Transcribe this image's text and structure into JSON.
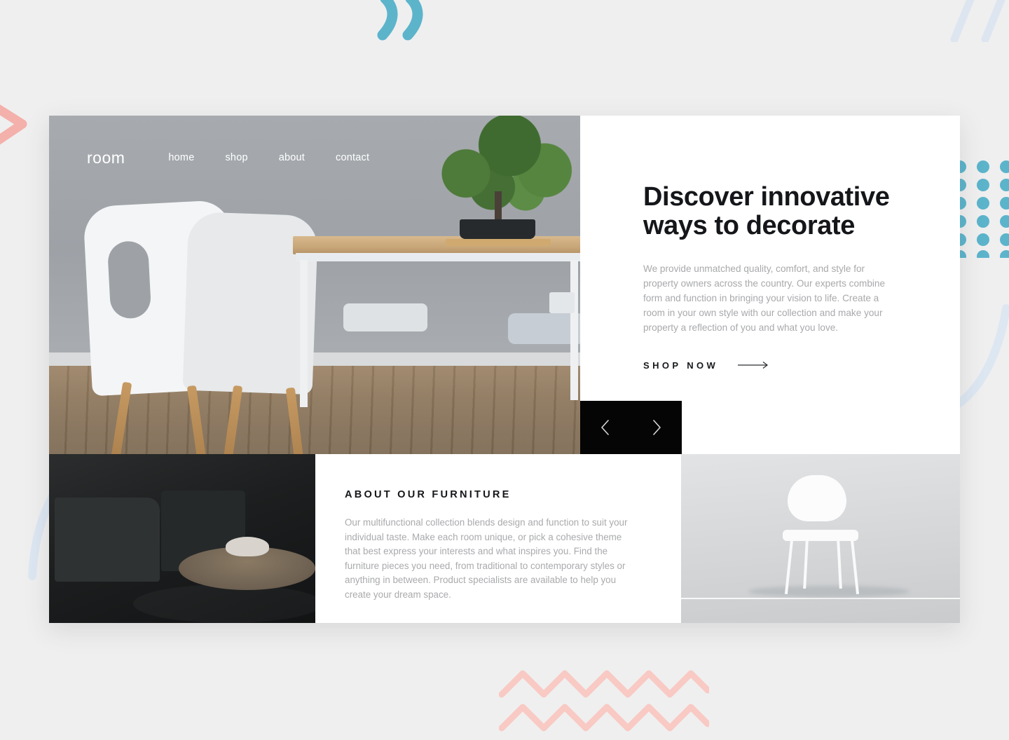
{
  "site": {
    "logo": "room",
    "nav": [
      {
        "label": "home",
        "name": "nav-link-home"
      },
      {
        "label": "shop",
        "name": "nav-link-shop"
      },
      {
        "label": "about",
        "name": "nav-link-about"
      },
      {
        "label": "contact",
        "name": "nav-link-contact"
      }
    ]
  },
  "hero": {
    "title": "Discover innovative ways to decorate",
    "paragraph": "We provide unmatched quality, comfort, and style for property owners across the country. Our experts combine form and function in bringing your vision to life. Create a room in your own style with our collection and make your property a reflection of you and what you love.",
    "cta_label": "SHOP NOW",
    "cta_icon": "arrow-right-icon"
  },
  "carousel": {
    "prev_icon": "chevron-left-icon",
    "next_icon": "chevron-right-icon",
    "background": "#050505"
  },
  "about": {
    "title": "ABOUT OUR FURNITURE",
    "paragraph": "Our multifunctional collection blends design and function to suit your individual taste. Make each room unique, or pick a cohesive theme that best express your interests and what inspires you. Find the furniture pieces you need, from traditional to contemporary styles or anything in between. Product specialists are available to help you create your dream space."
  },
  "images": {
    "hero_photo": "dining-room-white-chairs-wood-table-bonsai",
    "bottom_left_photo": "dark-living-room-armchairs-round-coffee-table",
    "bottom_right_photo": "white-modern-chair-on-light-background"
  },
  "decorations": [
    {
      "name": "quote-marks-decoration",
      "color": "#5cb4cb",
      "position": "top-center"
    },
    {
      "name": "diagonal-slashes-decoration",
      "color": "#dde6f0",
      "position": "top-right"
    },
    {
      "name": "dot-grid-decoration",
      "color": "#5cb4cb",
      "position": "right"
    },
    {
      "name": "zigzag-decoration",
      "color": "#f9c9c4",
      "position": "bottom-center"
    },
    {
      "name": "chevron-arrow-decoration",
      "color": "#f4b0ab",
      "position": "left"
    },
    {
      "name": "arc-curve-decoration",
      "color": "#dde7f2",
      "position": "right-middle"
    },
    {
      "name": "arc-curve-decoration",
      "color": "#dde7f2",
      "position": "left-lower"
    }
  ],
  "colors": {
    "page_background": "#efefef",
    "card_background": "#ffffff",
    "heading": "#14161a",
    "body_text": "#a8a9ac",
    "accent_teal": "#5cb4cb",
    "accent_pink": "#f9c9c4",
    "accent_blue": "#dde7f2"
  }
}
